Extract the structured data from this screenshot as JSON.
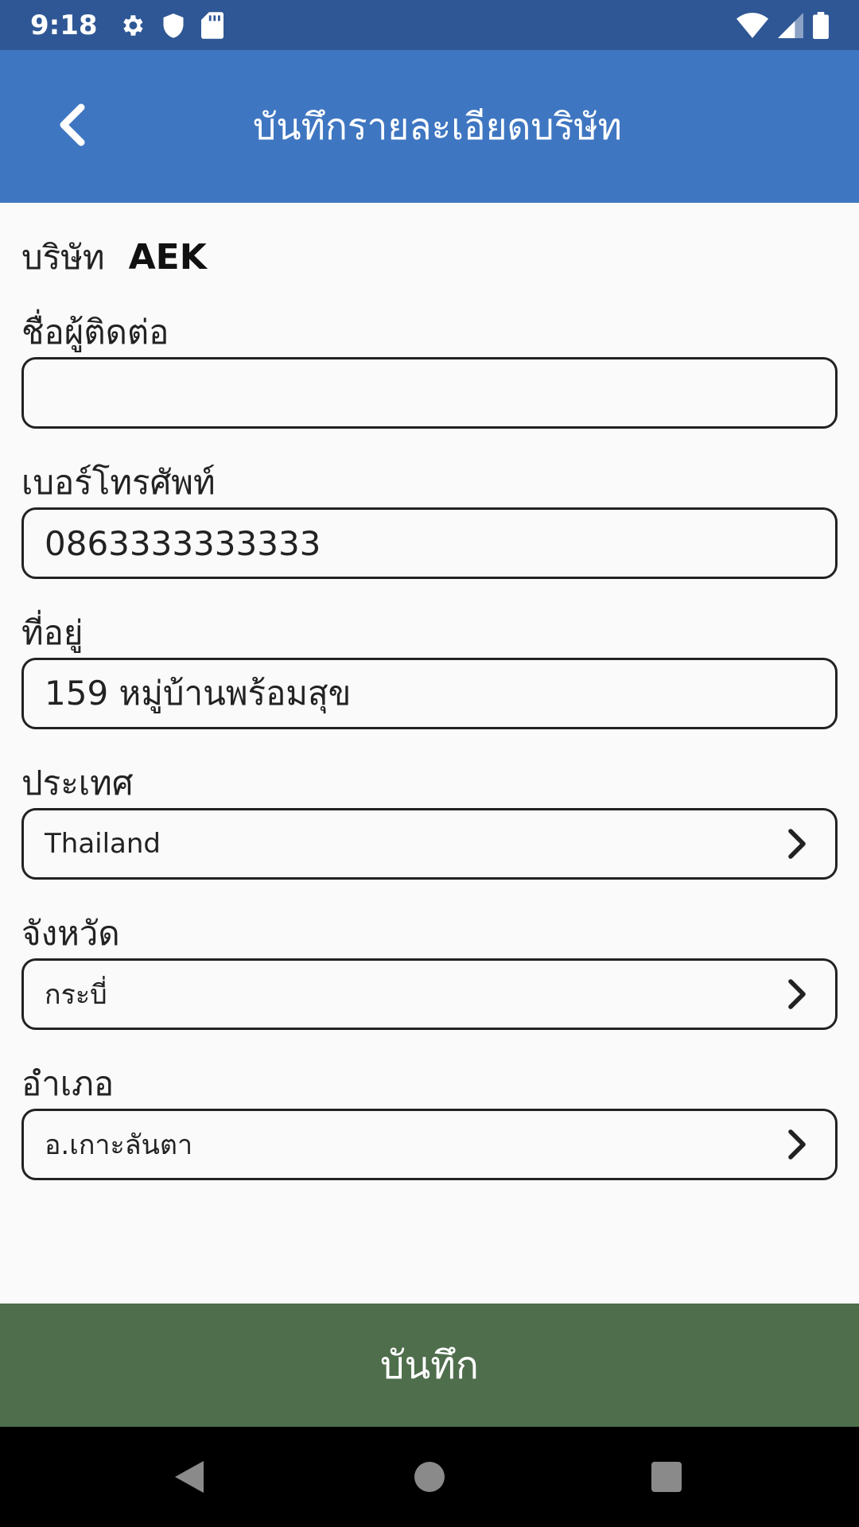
{
  "status_bar": {
    "time": "9:18",
    "left_icons": [
      "gear-icon",
      "shield-icon",
      "sd-card-icon"
    ],
    "right_icons": [
      "wifi-icon",
      "cell-signal-icon",
      "battery-icon"
    ]
  },
  "app_bar": {
    "title": "บันทึกรายละเอียดบริษัท",
    "back_icon": "chevron-left-icon"
  },
  "company": {
    "label": "บริษัท",
    "value": "AEK"
  },
  "fields": {
    "contact_name": {
      "label": "ชื่อผู้ติดต่อ",
      "value": ""
    },
    "phone": {
      "label": "เบอร์โทรศัพท์",
      "value": "0863333333333"
    },
    "address": {
      "label": "ที่อยู่",
      "value": "159 หมู่บ้านพร้อมสุข"
    },
    "country": {
      "label": "ประเทศ",
      "value": "Thailand"
    },
    "province": {
      "label": "จังหวัด",
      "value": "กระบี่"
    },
    "district": {
      "label": "อำเภอ",
      "value": "อ.เกาะลันตา"
    }
  },
  "save_button": {
    "label": "บันทึก"
  },
  "colors": {
    "status_bar": "#2f5795",
    "app_bar": "#3f76c1",
    "save_button": "#4f6e4c",
    "background": "#fafafa"
  }
}
